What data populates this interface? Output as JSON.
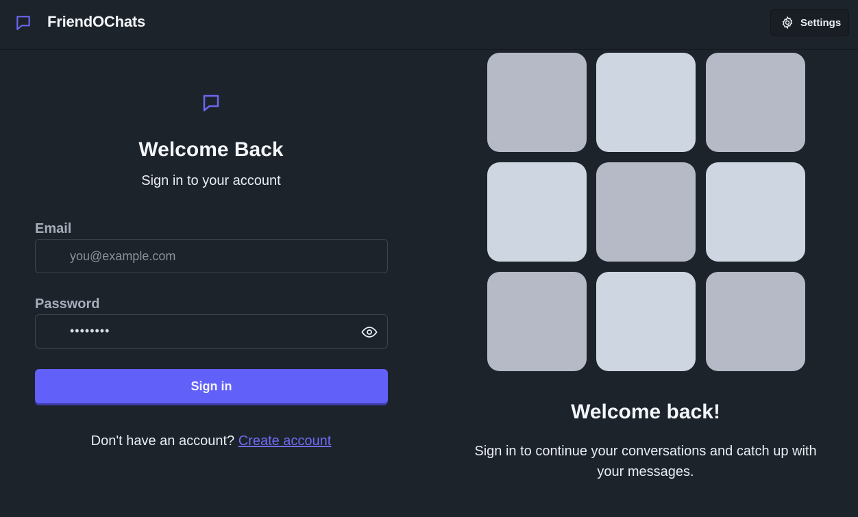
{
  "app": {
    "name": "FriendOChats",
    "brand_icon": "chat-bubble-icon",
    "accent_color": "#6160f8"
  },
  "navbar": {
    "settings_label": "Settings",
    "settings_icon": "gear-icon"
  },
  "login": {
    "hero_icon": "chat-bubble-icon",
    "title": "Welcome Back",
    "subtitle": "Sign in to your account",
    "email": {
      "label": "Email",
      "placeholder": "you@example.com",
      "value": ""
    },
    "password": {
      "label": "Password",
      "masked_value": "••••••••",
      "toggle_icon": "eye-icon"
    },
    "submit_label": "Sign in",
    "signup_prompt": "Don't have an account?",
    "signup_link": "Create account"
  },
  "promo": {
    "tile_colors": [
      "#b5bac6",
      "#cdd6e1"
    ],
    "title": "Welcome back!",
    "description": "Sign in to continue your conversations and catch up with your messages."
  }
}
